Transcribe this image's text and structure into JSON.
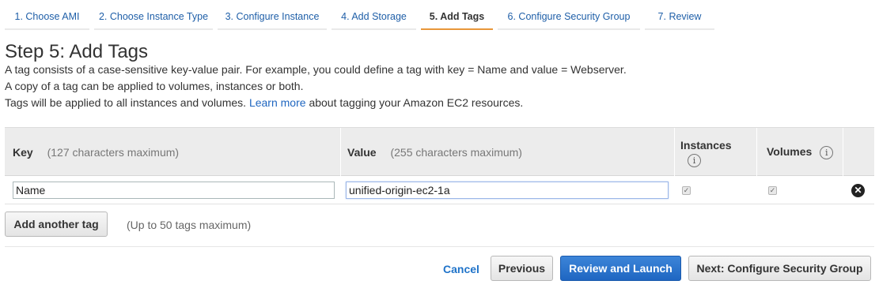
{
  "wizard": {
    "steps": [
      {
        "label": "1. Choose AMI"
      },
      {
        "label": "2. Choose Instance Type"
      },
      {
        "label": "3. Configure Instance"
      },
      {
        "label": "4. Add Storage"
      },
      {
        "label": "5. Add Tags"
      },
      {
        "label": "6. Configure Security Group"
      },
      {
        "label": "7. Review"
      }
    ],
    "active_step": "5. Add Tags"
  },
  "page": {
    "title": "Step 5: Add Tags",
    "line1": "A tag consists of a case-sensitive key-value pair. For example, you could define a tag with key = Name and value = Webserver.",
    "line2": "A copy of a tag can be applied to volumes, instances or both.",
    "line3_before": "Tags will be applied to all instances and volumes.",
    "line3_link": "Learn more",
    "line3_after": "about tagging your Amazon EC2 resources."
  },
  "table": {
    "key_header": "Key",
    "key_hint": "(127 characters maximum)",
    "value_header": "Value",
    "value_hint": "(255 characters maximum)",
    "instances_header": "Instances",
    "volumes_header": "Volumes",
    "info_icon": "i",
    "rows": [
      {
        "key": "Name",
        "value": "unified-origin-ec2-1a",
        "instances": true,
        "volumes": true
      }
    ]
  },
  "actions": {
    "add_tag": "Add another tag",
    "add_tag_note": "(Up to 50 tags maximum)",
    "cancel": "Cancel",
    "previous": "Previous",
    "review_launch": "Review and Launch",
    "next": "Next: Configure Security Group"
  },
  "colors": {
    "accent": "#1f66c2",
    "active_tab_underline": "#e8963a"
  }
}
